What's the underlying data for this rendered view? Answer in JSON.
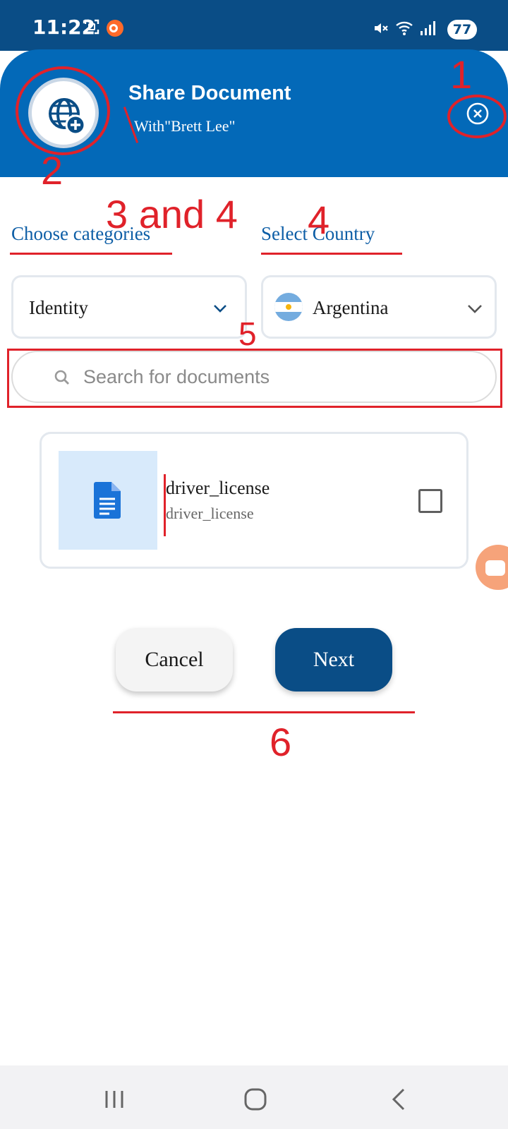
{
  "status_bar": {
    "time": "11:22",
    "battery": "77",
    "icons": [
      "screenshot-icon",
      "screen-recorder-icon",
      "mute-icon",
      "wifi-icon",
      "signal-icon"
    ]
  },
  "header": {
    "title": "Share Document",
    "subtitle": "With\"Brett Lee\"",
    "avatar_icon": "globe-add-icon",
    "close_icon": "close-circle-icon",
    "background_color": "#0369b8"
  },
  "filters": {
    "category_label": "Choose categories",
    "category_value": "Identity",
    "country_label": "Select Country",
    "country_value": "Argentina"
  },
  "search": {
    "placeholder": "Search for documents"
  },
  "documents": [
    {
      "title": "driver_license",
      "subtitle": "driver_license",
      "checked": false
    }
  ],
  "actions": {
    "cancel_label": "Cancel",
    "next_label": "Next"
  },
  "annotations": [
    "1",
    "2",
    "3 and 4",
    "4",
    "5",
    "6"
  ],
  "colors": {
    "primary": "#0a4d86",
    "accent_blue": "#0d5ea6",
    "annotation_red": "#e0222a"
  }
}
